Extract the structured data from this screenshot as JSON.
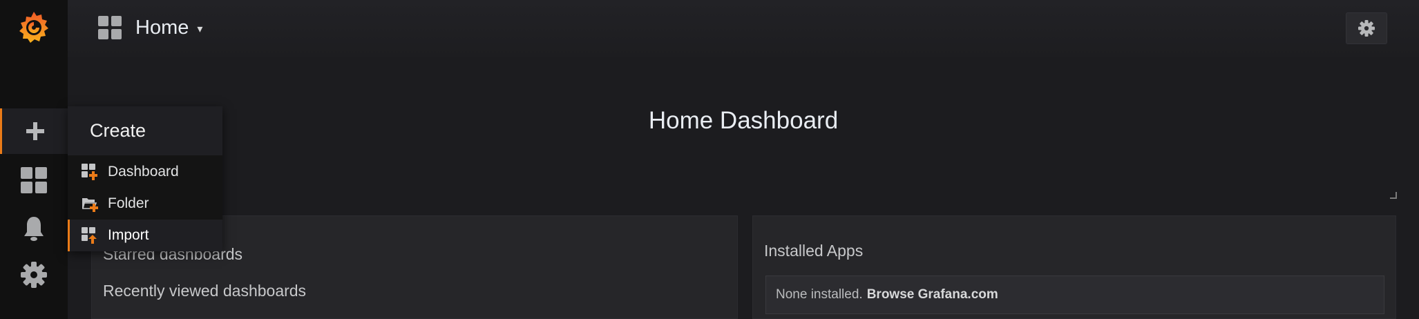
{
  "header": {
    "title": "Home",
    "settings_icon": "gear-icon"
  },
  "sidebar": {
    "logo": "grafana-logo",
    "items": [
      {
        "icon": "plus-icon",
        "label": "Create"
      },
      {
        "icon": "dashboards-icon",
        "label": "Dashboards"
      },
      {
        "icon": "bell-icon",
        "label": "Alerting"
      },
      {
        "icon": "gear-icon",
        "label": "Configuration"
      }
    ]
  },
  "create_menu": {
    "title": "Create",
    "items": [
      {
        "label": "Dashboard",
        "icon": "add-dashboard-icon"
      },
      {
        "label": "Folder",
        "icon": "add-folder-icon"
      },
      {
        "label": "Import",
        "icon": "import-icon"
      }
    ]
  },
  "dashboard": {
    "title": "Home Dashboard"
  },
  "panels": {
    "left": {
      "starred": "Starred dashboards",
      "recent": "Recently viewed dashboards"
    },
    "right": {
      "title": "Installed Apps",
      "empty_text": "None installed.",
      "browse_link": "Browse Grafana.com"
    }
  },
  "colors": {
    "accent": "#eb7b18",
    "background": "#1c1c1f",
    "sidebar": "#111111"
  }
}
